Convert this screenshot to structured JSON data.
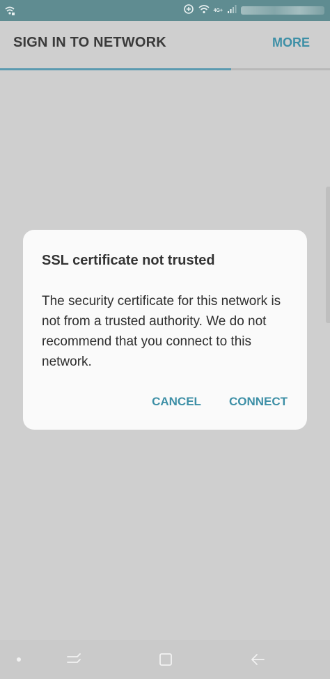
{
  "app_bar": {
    "title": "SIGN IN TO NETWORK",
    "more_label": "MORE"
  },
  "status_bar": {
    "network_label": "4G+"
  },
  "progress": {
    "value_percent": 70
  },
  "dialog": {
    "title": "SSL certificate not trusted",
    "message": "The security certificate for this network is not from a trusted authority. We do not recommend that you connect to this network.",
    "cancel_label": "CANCEL",
    "connect_label": "CONNECT"
  },
  "colors": {
    "status_bar": "#5f8c91",
    "accent": "#3d8fa6",
    "background": "#cfcfcf"
  },
  "icons": {
    "status_left": "wifi-call-icon",
    "data_saver": "data-saver-icon",
    "wifi": "wifi-icon",
    "signal": "signal-icon",
    "nav_dot": "nav-dot-icon",
    "recents": "recents-icon",
    "home": "home-icon",
    "back": "back-icon"
  }
}
